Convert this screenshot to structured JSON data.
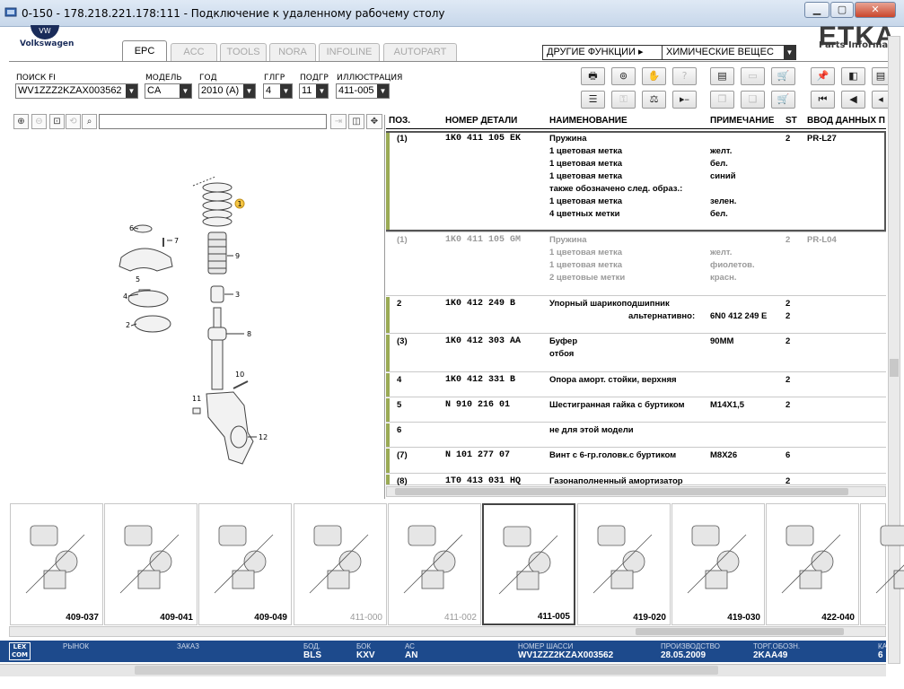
{
  "window": {
    "title": "0-150 - 178.218.221.178:111 - Подключение к удаленному рабочему столу",
    "min": "▁",
    "max": "▢",
    "close": "✕"
  },
  "brand": {
    "vw": "Volkswagen",
    "etka": "ETKA",
    "parts": "Parts Informati"
  },
  "tabs": [
    {
      "label": "EPC",
      "active": true
    },
    {
      "label": "ACC"
    },
    {
      "label": "TOOLS"
    },
    {
      "label": "NORA"
    },
    {
      "label": "INFOLINE"
    },
    {
      "label": "AUTOPART"
    }
  ],
  "functions": {
    "other": "ДРУГИЕ ФУНКЦИИ",
    "chem": "ХИМИЧЕСКИЕ ВЕЩЕС"
  },
  "filters": {
    "fi": {
      "label": "ПОИСК FI",
      "value": "WV1ZZZ2KZAX003562"
    },
    "model": {
      "label": "МОДЕЛЬ",
      "value": "CA"
    },
    "year": {
      "label": "ГОД",
      "value": "2010 (A)"
    },
    "mg": {
      "label": "ГЛГР",
      "value": "4"
    },
    "sg": {
      "label": "ПОДГР",
      "value": "11"
    },
    "ill": {
      "label": "ИЛЛЮСТРАЦИЯ",
      "value": "411-005"
    }
  },
  "table": {
    "headers": [
      "ПОЗ.",
      "НОМЕР ДЕТАЛИ",
      "НАИМЕНОВАНИЕ",
      "ПРИМЕЧАНИЕ",
      "ST",
      "ВВОД ДАННЫХ П"
    ],
    "rows": [
      {
        "pos": "(1)",
        "part": "1K0  411  105  EK",
        "lines": [
          [
            "Пружина",
            "",
            "2",
            "PR-L27"
          ],
          [
            "1 цветовая метка",
            "желт.",
            "",
            ""
          ],
          [
            "1 цветовая метка",
            "бел.",
            "",
            ""
          ],
          [
            "1 цветовая метка",
            "синий",
            "",
            ""
          ],
          [
            "также обозначено след. образ.:",
            "",
            "",
            ""
          ],
          [
            "1 цветовая метка",
            "зелен.",
            "",
            ""
          ],
          [
            "4 цветных метки",
            "бел.",
            "",
            ""
          ]
        ]
      },
      {
        "pos": "(1)",
        "part": "1K0  411  105  GM",
        "grey": true,
        "lines": [
          [
            "Пружина",
            "",
            "2",
            "PR-L04"
          ],
          [
            "1 цветовая метка",
            "желт.",
            "",
            ""
          ],
          [
            "1 цветовая метка",
            "фиолетов.",
            "",
            ""
          ],
          [
            "2 цветовые метки",
            "красн.",
            "",
            ""
          ]
        ]
      },
      {
        "pos": "2",
        "part": "1K0  412  249  B",
        "lines": [
          [
            "Упорный шарикоподшипник",
            "",
            "2",
            ""
          ],
          [
            "альтернативно:",
            "6N0 412 249 E",
            "2",
            ""
          ]
        ]
      },
      {
        "pos": "(3)",
        "part": "1K0  412  303  AA",
        "lines": [
          [
            "Буфер",
            "90MM",
            "2",
            ""
          ],
          [
            "отбоя",
            "",
            "",
            ""
          ]
        ]
      },
      {
        "pos": "4",
        "part": "1K0  412  331  B",
        "lines": [
          [
            "Опора аморт. стойки, верхняя",
            "",
            "2",
            ""
          ]
        ]
      },
      {
        "pos": "5",
        "part": "N    910  216  01",
        "lines": [
          [
            "Шестигранная гайка с буртиком",
            "M14X1,5",
            "2",
            ""
          ]
        ]
      },
      {
        "pos": "6",
        "part": "",
        "lines": [
          [
            "не для этой модели",
            "",
            "",
            ""
          ]
        ]
      },
      {
        "pos": "(7)",
        "part": "N    101  277  07",
        "lines": [
          [
            "Винт с 6-гр.головк.с буртиком",
            "M8X26",
            "6",
            ""
          ]
        ]
      },
      {
        "pos": "(8)",
        "part": "1T0  413  031  HQ",
        "lines": [
          [
            "Газонаполненный амортизатор",
            "",
            "2",
            ""
          ]
        ]
      }
    ]
  },
  "callouts": [
    "1",
    "2",
    "3",
    "4",
    "5",
    "6",
    "7",
    "8",
    "9",
    "10",
    "11",
    "12"
  ],
  "thumbnails": [
    {
      "label": "409-037"
    },
    {
      "label": "409-041"
    },
    {
      "label": "409-049"
    },
    {
      "label": "411-000",
      "grey": true
    },
    {
      "label": "411-002",
      "grey": true
    },
    {
      "label": "411-005",
      "selected": true
    },
    {
      "label": "419-020"
    },
    {
      "label": "419-030"
    },
    {
      "label": "422-040"
    },
    {
      "label": ""
    }
  ],
  "status": {
    "lexcom": "LEX COM",
    "market": "РЫНОК",
    "order": "ЗАКАЗ",
    "bod": {
      "label": "БОД.",
      "value": "BLS"
    },
    "bok": {
      "label": "БОК",
      "value": "KXV"
    },
    "ac": {
      "label": "АС",
      "value": "AN"
    },
    "chassis": {
      "label": "НОМЕР ШАССИ",
      "value": "WV1ZZZ2KZAX003562"
    },
    "prod": {
      "label": "ПРОИЗВОДСТВО",
      "value": "28.05.2009"
    },
    "trade": {
      "label": "ТОРГ.ОБОЗН.",
      "value": "2KAA49"
    },
    "k": {
      "label": "КА",
      "value": "6"
    }
  }
}
